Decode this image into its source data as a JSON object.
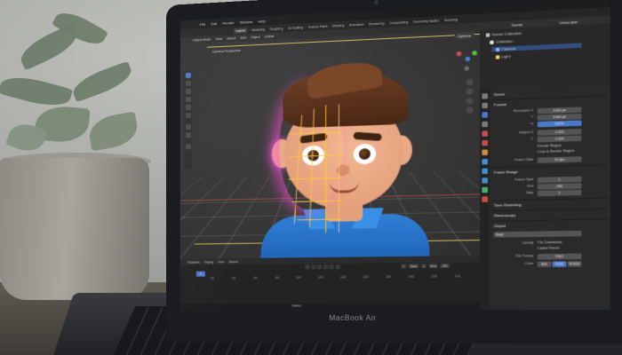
{
  "colors": {
    "selection_blue": "#4c79c9",
    "shirt_blue": "#2f7fd6",
    "hair_brown": "#6b3d22",
    "rig_highlight": "#ff4fd8",
    "camera_frame": "#c9b55a"
  },
  "laptop": {
    "brand_label": "MacBook Air"
  },
  "topbar": {
    "menus": [
      "File",
      "Edit",
      "Render",
      "Window",
      "Help"
    ]
  },
  "workspace_tabs": [
    "Layout",
    "Modeling",
    "Sculpting",
    "UV Editing",
    "Texture Paint",
    "Shading",
    "Animation",
    "Rendering",
    "Compositing",
    "Geometry Nodes",
    "Scripting"
  ],
  "viewport": {
    "header": [
      "Object Mode",
      "View",
      "Select",
      "Add",
      "Object",
      "Global"
    ],
    "options_label": "Options",
    "camera_label": "Camera Perspective"
  },
  "outliner": {
    "scene_label": "Scene",
    "viewlayer_label": "ViewLayer",
    "rows": [
      "Scene Collection",
      "Collection",
      "Camera",
      "Light"
    ]
  },
  "properties": {
    "scene_label": "Scene",
    "format_section": "Format",
    "resolution_x_label": "Resolution X",
    "resolution_x": "1920 px",
    "resolution_y_label": "Y",
    "resolution_y": "1080 px",
    "percent_label": "%",
    "percent": "100%",
    "aspect_x_label": "Aspect X",
    "aspect_x": "1.000",
    "aspect_y_label": "Y",
    "aspect_y": "1.000",
    "render_region": "Render Region",
    "crop_region": "Crop to Render Region",
    "frame_rate_label": "Frame Rate",
    "frame_rate": "24 fps",
    "frame_range_section": "Frame Range",
    "frame_start_label": "Frame Start",
    "frame_start": "1",
    "frame_end_label": "End",
    "frame_end": "250",
    "frame_step_label": "Step",
    "frame_step": "1",
    "time_stretching": "Time Stretching",
    "stereoscopy": "Stereoscopy",
    "output_section": "Output",
    "output_path": "/tmp/",
    "saving_label": "Saving",
    "file_extensions": "File Extensions",
    "cache_result": "Cache Result",
    "file_format_label": "File Format",
    "file_format": "PNG",
    "color_label": "Color",
    "color_bw": "BW",
    "color_rgb": "RGB",
    "color_rgba": "RGBA"
  },
  "timeline": {
    "header": [
      "Playback",
      "Keying",
      "View",
      "Marker"
    ],
    "current_frame": "1",
    "start_label": "Start",
    "start": "1",
    "end_label": "End",
    "end": "250",
    "ticks": [
      "20",
      "40",
      "60",
      "80",
      "100",
      "120",
      "140",
      "160",
      "180",
      "200",
      "220",
      "240"
    ],
    "status_select": "Select"
  }
}
